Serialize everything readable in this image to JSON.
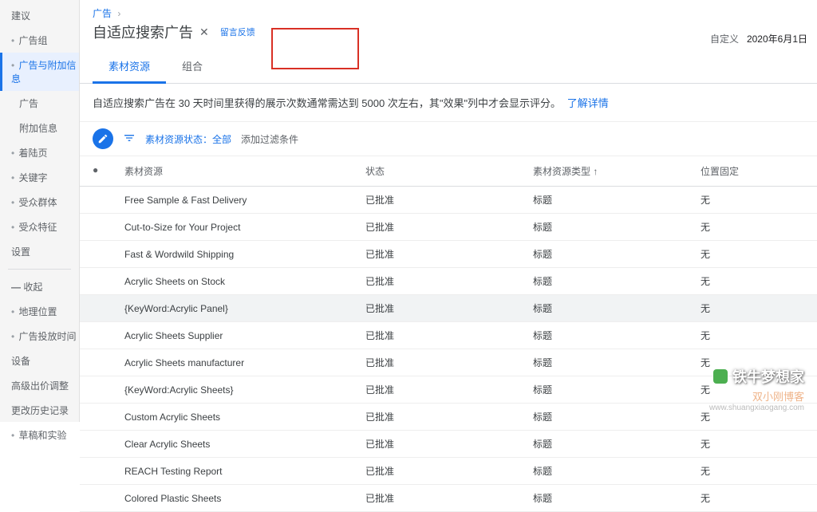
{
  "sidebar": {
    "items": [
      {
        "label": "建议"
      },
      {
        "label": "广告组",
        "bullet": true
      },
      {
        "label": "广告与附加信息",
        "bullet": true,
        "active": true
      },
      {
        "label": "广告",
        "sub": true
      },
      {
        "label": "附加信息",
        "sub": true
      },
      {
        "label": "着陆页",
        "bullet": true
      },
      {
        "label": "关键字",
        "bullet": true
      },
      {
        "label": "受众群体",
        "bullet": true
      },
      {
        "label": "受众特征",
        "bullet": true
      },
      {
        "label": "设置"
      },
      {
        "label": "收起",
        "collapse": true,
        "divider_before": true
      },
      {
        "label": "地理位置",
        "bullet": true
      },
      {
        "label": "广告投放时间",
        "bullet": true
      },
      {
        "label": "设备"
      },
      {
        "label": "高级出价调整"
      },
      {
        "label": "更改历史记录"
      },
      {
        "label": "草稿和实验",
        "bullet": true
      }
    ]
  },
  "breadcrumb": {
    "root": "广告",
    "sep": "›"
  },
  "page_title": "自适应搜索广告",
  "feedback_link": "留言反馈",
  "tabs": [
    {
      "label": "素材资源",
      "active": true
    },
    {
      "label": "组合"
    }
  ],
  "topright": {
    "custom": "自定义",
    "date": "2020年6月1日"
  },
  "notice": {
    "text": "自适应搜索广告在 30 天时间里获得的展示次数通常需达到 5000 次左右，其\"效果\"列中才会显示评分。",
    "link": "了解详情"
  },
  "toolbar": {
    "status_filter_label": "素材资源状态：",
    "status_filter_value": "全部",
    "add_filter": "添加过滤条件"
  },
  "columns": {
    "asset": "素材资源",
    "status": "状态",
    "type": "素材资源类型",
    "pinned": "位置固定"
  },
  "rows": [
    {
      "asset": "Free Sample & Fast Delivery",
      "status": "已批准",
      "type": "标题",
      "pinned": "无"
    },
    {
      "asset": "Cut-to-Size for Your Project",
      "status": "已批准",
      "type": "标题",
      "pinned": "无"
    },
    {
      "asset": "Fast & Wordwild Shipping",
      "status": "已批准",
      "type": "标题",
      "pinned": "无"
    },
    {
      "asset": "Acrylic Sheets on Stock",
      "status": "已批准",
      "type": "标题",
      "pinned": "无"
    },
    {
      "asset": "{KeyWord:Acrylic Panel}",
      "status": "已批准",
      "type": "标题",
      "pinned": "无",
      "hl": true
    },
    {
      "asset": "Acrylic Sheets Supplier",
      "status": "已批准",
      "type": "标题",
      "pinned": "无"
    },
    {
      "asset": "Acrylic Sheets manufacturer",
      "status": "已批准",
      "type": "标题",
      "pinned": "无"
    },
    {
      "asset": "{KeyWord:Acrylic Sheets}",
      "status": "已批准",
      "type": "标题",
      "pinned": "无"
    },
    {
      "asset": "Custom Acrylic Sheets",
      "status": "已批准",
      "type": "标题",
      "pinned": "无"
    },
    {
      "asset": "Clear Acrylic Sheets",
      "status": "已批准",
      "type": "标题",
      "pinned": "无"
    },
    {
      "asset": "REACH Testing Report",
      "status": "已批准",
      "type": "标题",
      "pinned": "无"
    },
    {
      "asset": "Colored Plastic Sheets",
      "status": "已批准",
      "type": "标题",
      "pinned": "无"
    }
  ],
  "watermark": {
    "line1": "铁牛梦想家",
    "line2": "双小刚博客",
    "line3": "www.shuangxiaogang.com"
  }
}
